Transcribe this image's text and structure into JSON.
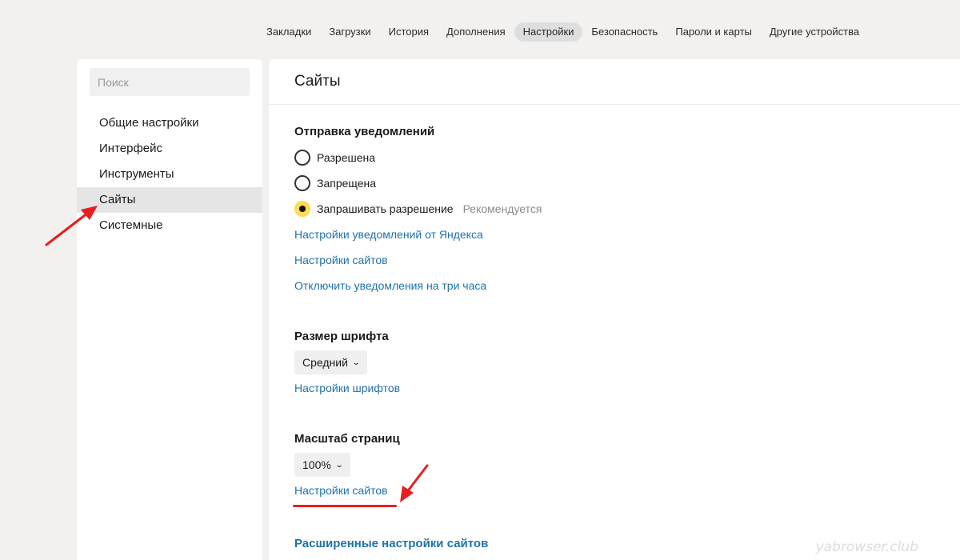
{
  "topnav": {
    "items": [
      {
        "label": "Закладки"
      },
      {
        "label": "Загрузки"
      },
      {
        "label": "История"
      },
      {
        "label": "Дополнения"
      },
      {
        "label": "Настройки"
      },
      {
        "label": "Безопасность"
      },
      {
        "label": "Пароли и карты"
      },
      {
        "label": "Другие устройства"
      }
    ],
    "active": "Настройки"
  },
  "sidebar": {
    "search_placeholder": "Поиск",
    "items": [
      {
        "label": "Общие настройки"
      },
      {
        "label": "Интерфейс"
      },
      {
        "label": "Инструменты"
      },
      {
        "label": "Сайты"
      },
      {
        "label": "Системные"
      }
    ],
    "active": "Сайты"
  },
  "main": {
    "title": "Сайты",
    "notifications": {
      "title": "Отправка уведомлений",
      "options": [
        {
          "label": "Разрешена",
          "checked": false
        },
        {
          "label": "Запрещена",
          "checked": false
        },
        {
          "label": "Запрашивать разрешение",
          "checked": true,
          "hint": "Рекомендуется"
        }
      ],
      "links": [
        "Настройки уведомлений от Яндекса",
        "Настройки сайтов",
        "Отключить уведомления на три часа"
      ]
    },
    "font_size": {
      "title": "Размер шрифта",
      "selected": "Средний",
      "link": "Настройки шрифтов"
    },
    "zoom": {
      "title": "Масштаб страниц",
      "selected": "100%",
      "link": "Настройки сайтов"
    },
    "advanced_link": "Расширенные настройки сайтов"
  },
  "watermark": "yabrowser.club",
  "colors": {
    "accent_radio": "#ffdb4d",
    "link": "#1e72ad",
    "annotation": "#e81e1e"
  }
}
